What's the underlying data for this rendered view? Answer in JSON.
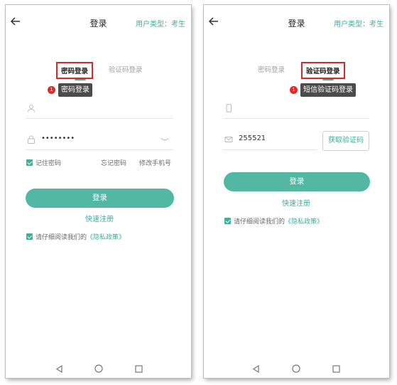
{
  "header": {
    "title": "登录",
    "user_type": "用户类型：考生"
  },
  "left": {
    "tabs": {
      "password": "密码登录",
      "sms": "验证码登录"
    },
    "callout": {
      "badge": "1",
      "text": "密码登录"
    },
    "username": {
      "placeholder": "",
      "value": ""
    },
    "password": {
      "masked_value": "••••••••"
    },
    "remember": "记住密码",
    "forgot": "忘记密码",
    "change_phone": "修改手机号",
    "login_button": "登录",
    "register": "快速注册",
    "policy_prefix": "请仔细阅读我们的",
    "policy_link": "《隐私政策》"
  },
  "right": {
    "tabs": {
      "password": "密码登录",
      "sms": "验证码登录"
    },
    "callout": {
      "badge": "1",
      "text": "短信验证码登录"
    },
    "phone": {
      "value": ""
    },
    "code": {
      "value": "255521"
    },
    "get_code": "获取验证码",
    "login_button": "登录",
    "register": "快速注册",
    "policy_prefix": "请仔细阅读我们的",
    "policy_link": "《隐私政策》"
  },
  "icons": [
    "back-arrow-icon",
    "user-icon",
    "lock-icon",
    "eye-closed-icon",
    "phone-icon",
    "mail-icon",
    "checkbox-icon",
    "nav-back-icon",
    "nav-home-icon",
    "nav-recents-icon"
  ],
  "colors": {
    "accent": "#3fae9b",
    "button": "#52b8a3",
    "highlight": "#d42a2a",
    "callout_bg": "#4b4b4b"
  }
}
